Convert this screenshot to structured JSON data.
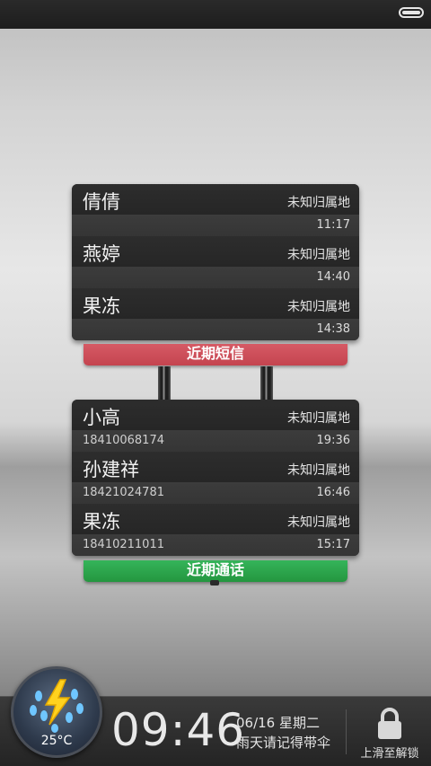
{
  "sms": {
    "label": "近期短信",
    "items": [
      {
        "name": "倩倩",
        "location": "未知归属地",
        "time": "11:17"
      },
      {
        "name": "燕婷",
        "location": "未知归属地",
        "time": "14:40"
      },
      {
        "name": "果冻",
        "location": "未知归属地",
        "time": "14:38"
      }
    ]
  },
  "calls": {
    "label": "近期通话",
    "items": [
      {
        "name": "小高",
        "location": "未知归属地",
        "number": "18410068174",
        "time": "19:36"
      },
      {
        "name": "孙建祥",
        "location": "未知归属地",
        "number": "18421024781",
        "time": "16:46"
      },
      {
        "name": "果冻",
        "location": "未知归属地",
        "number": "18410211011",
        "time": "15:17"
      }
    ]
  },
  "lockscreen": {
    "temperature": "25°C",
    "weather_icon": "thunderstorm-rain-icon",
    "clock": "09:46",
    "date": "06/16 星期二",
    "tip": "雨天请记得带伞",
    "unlock_label": "上滑至解锁"
  },
  "colors": {
    "sms_accent": "#c94a55",
    "call_accent": "#2ea14b"
  }
}
